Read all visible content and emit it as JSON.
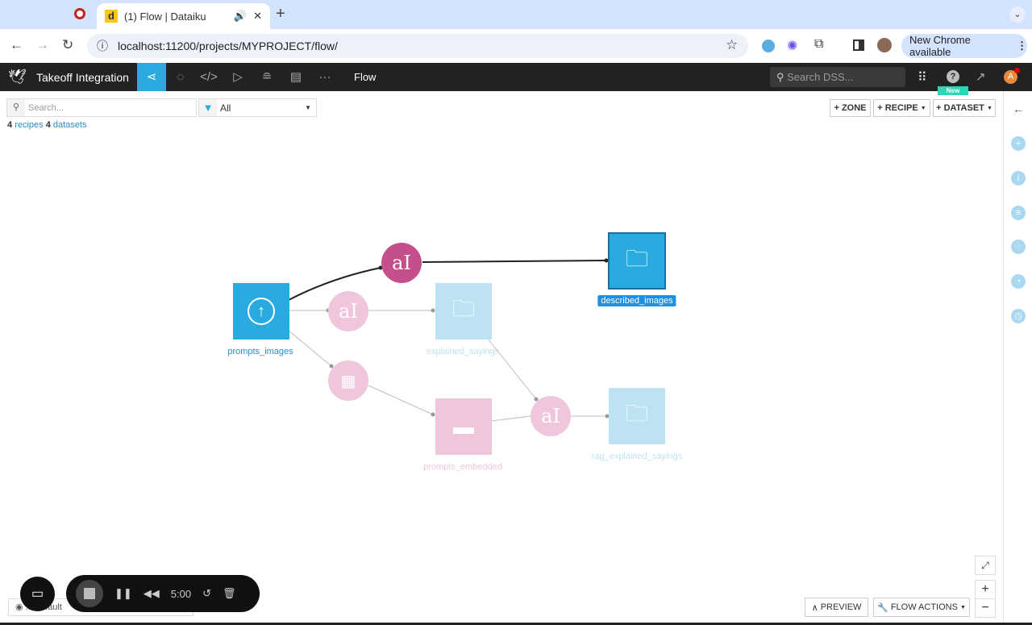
{
  "browser": {
    "tab_title": "(1) Flow | Dataiku",
    "url": "localhost:11200/projects/MYPROJECT/flow/",
    "update_label": "New Chrome available"
  },
  "app": {
    "project_name": "Takeoff Integration",
    "current_section": "Flow",
    "search_placeholder": "Search DSS...",
    "new_badge": "New",
    "avatar_letter": "A"
  },
  "toolbar": {
    "search_placeholder": "Search...",
    "filter_value": "All",
    "zone_label": "+ ZONE",
    "recipe_label": "+ RECIPE",
    "dataset_label": "+ DATASET"
  },
  "summary": {
    "recipes_count": "4",
    "recipes_label": "recipes",
    "datasets_count": "4",
    "datasets_label": "datasets"
  },
  "flow": {
    "datasets": [
      {
        "name": "prompts_images",
        "type": "upload"
      },
      {
        "name": "explained_sayings",
        "type": "folder"
      },
      {
        "name": "prompts_embedded",
        "type": "embedded"
      },
      {
        "name": "rag_explained_sayings",
        "type": "folder"
      },
      {
        "name": "described_images",
        "type": "folder",
        "selected": true
      }
    ],
    "recipe_glyph": "aI"
  },
  "bottom": {
    "preview_label": "PREVIEW",
    "flow_actions_label": "FLOW ACTIONS",
    "zone_label": "... default",
    "timer": "5:00"
  },
  "colors": {
    "accent": "#29abe0",
    "recipe": "#c44f8a",
    "nav": "#222222"
  }
}
